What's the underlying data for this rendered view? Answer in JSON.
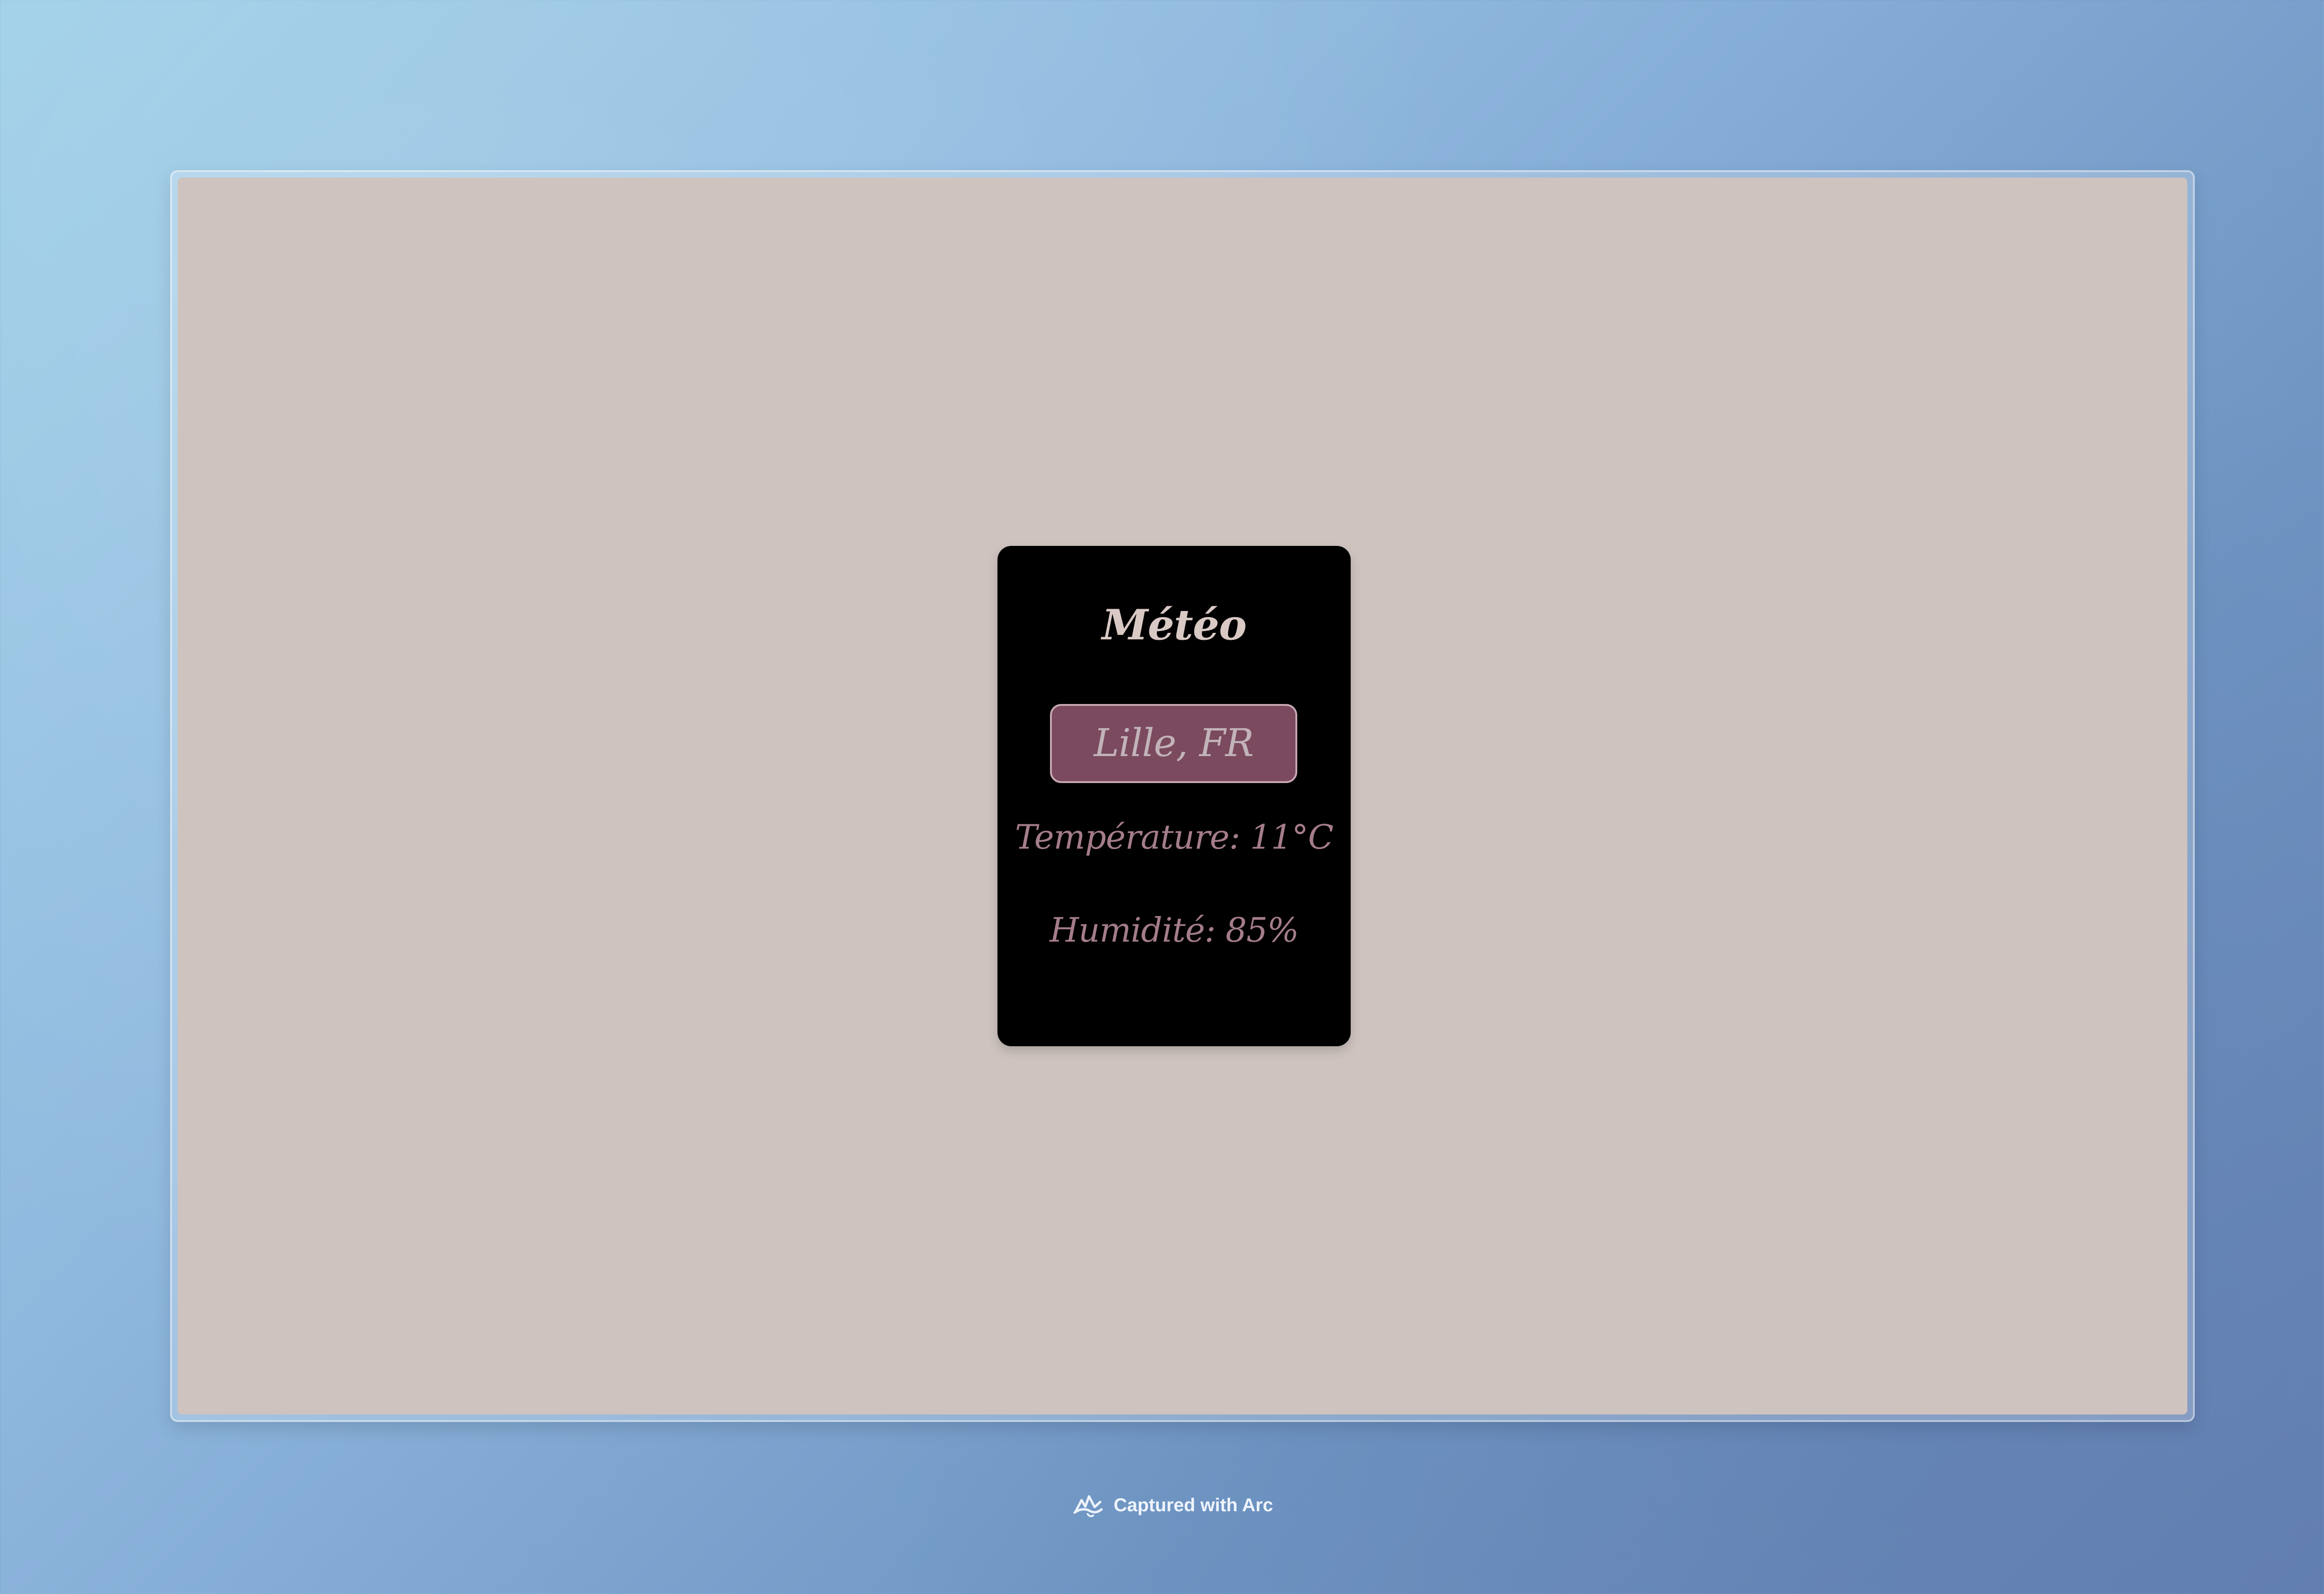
{
  "weather_widget": {
    "title": "Météo",
    "city_button_label": "Lille, FR",
    "temperature_text": "Température: 11°C",
    "humidity_text": "Humidité: 85%",
    "temperature_c": 11,
    "humidity_percent": 85
  },
  "capture_badge": {
    "text": "Captured with Arc",
    "icon": "arc-logo-icon"
  },
  "colors": {
    "page_background": "#cec3bf",
    "card_background": "#000000",
    "button_background": "#7b4a5f",
    "title_text": "#d9c9c4",
    "metric_text": "#a47d88",
    "outer_gradient_start": "#9fd0e8",
    "outer_gradient_end": "#6682b4"
  }
}
